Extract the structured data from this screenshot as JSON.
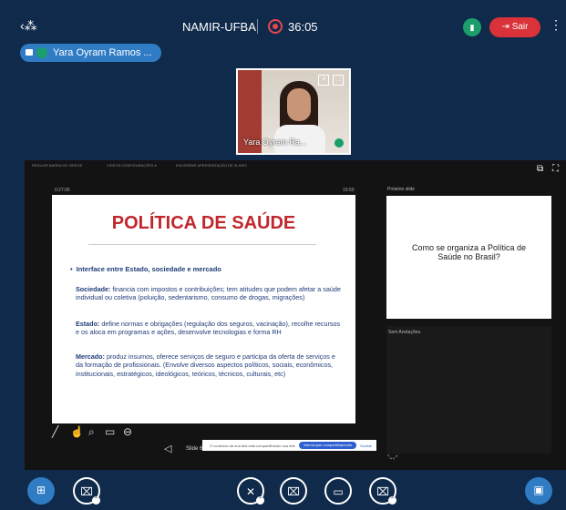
{
  "header": {
    "meeting_title": "NAMIR-UFBA",
    "recording_time": "36:05",
    "leave_button": "Sair",
    "presenter_name": "Yara Oyram Ramos ..."
  },
  "webcam": {
    "name": "Yara Oyram Ra..."
  },
  "presentation": {
    "toolbar": [
      "REDUZIR BARRA DE VIDEOS",
      "VIDEOS CONFIGURAÇÕES ▾",
      "ENCERRAR APRESENTAÇÃO DE SLIDES"
    ],
    "elapsed": "0:27:05",
    "clock": "19:50",
    "slide": {
      "title": "POLÍTICA DE SAÚDE",
      "bullet": "Interface entre Estado, sociedade e mercado",
      "paragraphs": [
        {
          "label": "Sociedade:",
          "text": " financia com impostos e contribuições; tem atitudes que podem afetar a saúde individual ou coletiva (poluição, sedentarismo, consumo de drogas, migrações)"
        },
        {
          "label": "Estado:",
          "text": " define normas e obrigações (regulação dos seguros, vacinação), recolhe recursos e os aloca em programas e ações, desenvolve tecnologias e forma RH"
        },
        {
          "label": "Mercado:",
          "text": " produz insumos, oferece serviços de seguro e participa da oferta de serviços e da formação de profissionais. (Envolve diversos aspectos políticos, sociais, econômicos, institucionais, estratégicos, ideológicos, teóricos, técnicos, culturais, etc)"
        }
      ]
    },
    "next_label": "Próximo slide",
    "next_slide_text": "Como se organiza a Política de Saúde no Brasil?",
    "notes_label": "Sem Anotações.",
    "slide_nav_label": "Slide 6",
    "share_banner": {
      "text": "O conteúdo da sua tela está compartilhando sua tela",
      "button": "Interromper compartilhamento",
      "help": "Ocultar"
    }
  },
  "icons": {
    "back": "back-arrow-icon",
    "more": "more-vertical-icon",
    "connection": "signal-icon",
    "apps": "apps-icon",
    "camera_off": "camera-off-icon",
    "mic_off": "mic-off-icon",
    "present": "present-icon",
    "chat": "chat-icon"
  },
  "colors": {
    "bg": "#0f2a4a",
    "accent": "#2f7cc4",
    "leave": "#d9323a",
    "slide_title": "#c0272d",
    "slide_text": "#1f3c78"
  }
}
